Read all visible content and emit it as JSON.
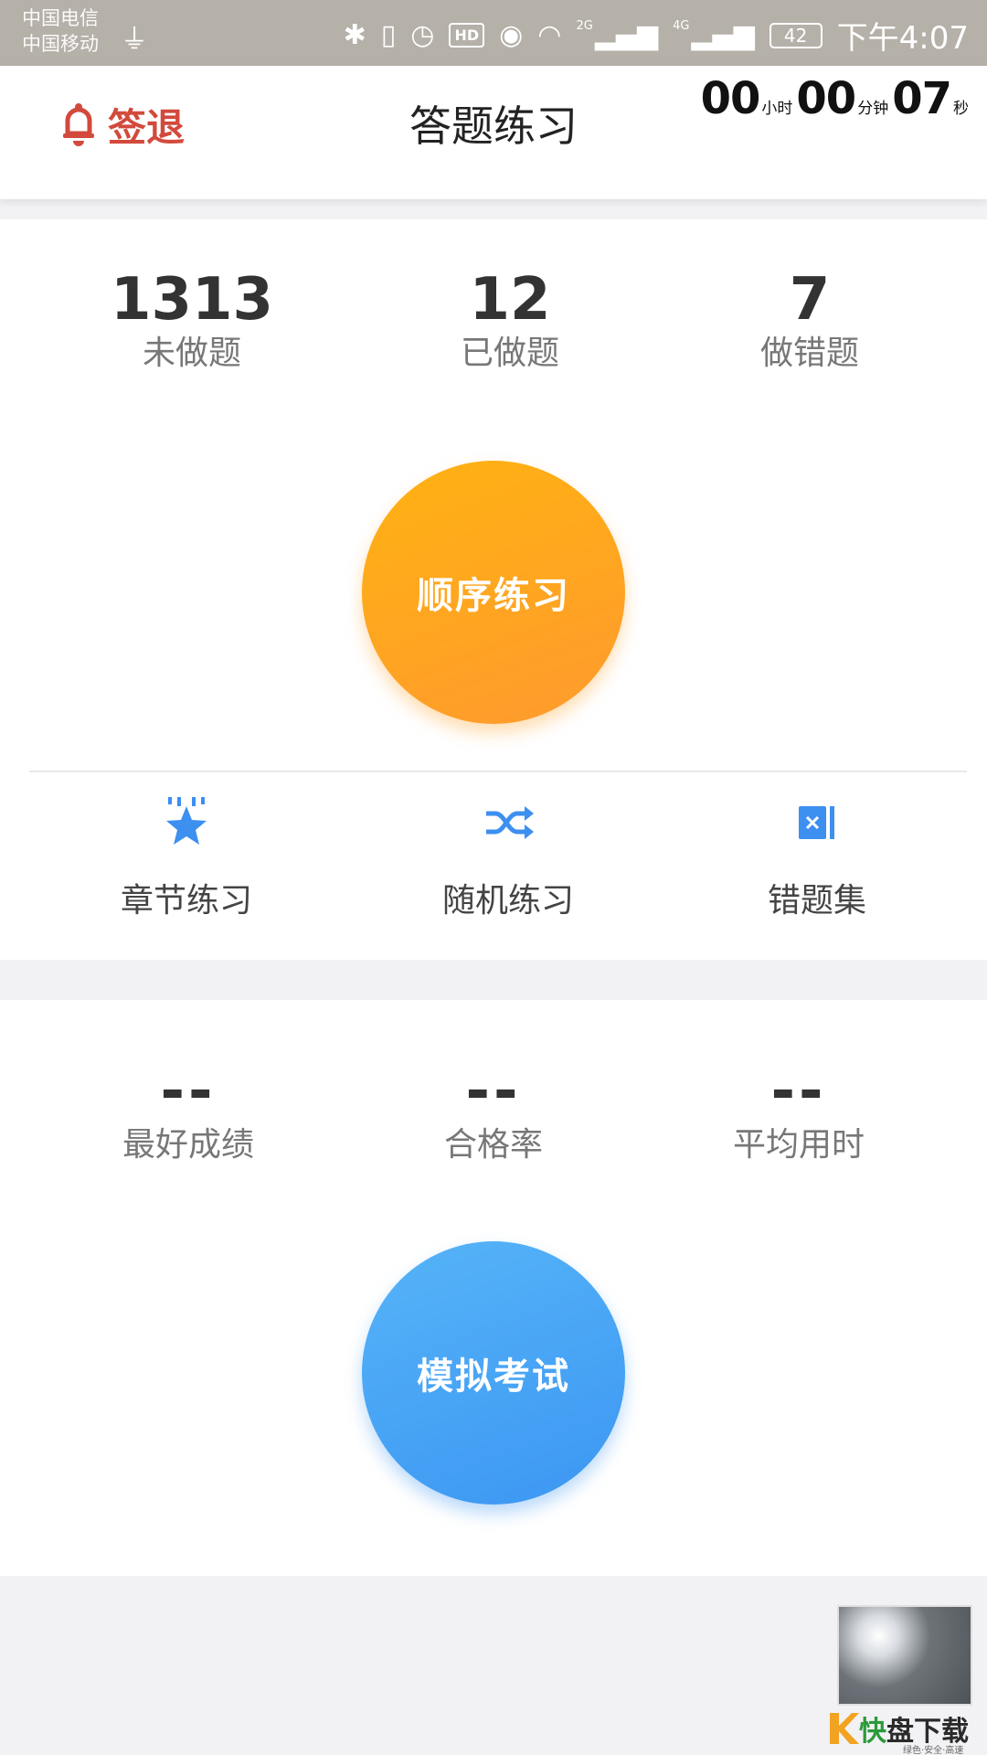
{
  "status_bar": {
    "carrier1": "中国电信",
    "carrier2": "中国移动",
    "network_2g": "2G",
    "network_4g": "4G",
    "hd": "HD",
    "battery": "42",
    "time": "下午4:07"
  },
  "header": {
    "signout_label": "签退",
    "title": "答题练习",
    "timer": {
      "hours": "00",
      "hours_unit": "小时",
      "minutes": "00",
      "minutes_unit": "分钟",
      "seconds": "07",
      "seconds_unit": "秒"
    }
  },
  "practice": {
    "stats": [
      {
        "value": "1313",
        "label": "未做题"
      },
      {
        "value": "12",
        "label": "已做题"
      },
      {
        "value": "7",
        "label": "做错题"
      }
    ],
    "main_button": "顺序练习",
    "modes": [
      {
        "label": "章节练习",
        "icon": "star-icon"
      },
      {
        "label": "随机练习",
        "icon": "shuffle-icon"
      },
      {
        "label": "错题集",
        "icon": "wrong-book-icon"
      }
    ]
  },
  "exam": {
    "stats": [
      {
        "value": "--",
        "label": "最好成绩"
      },
      {
        "value": "--",
        "label": "合格率"
      },
      {
        "value": "--",
        "label": "平均用时"
      }
    ],
    "main_button": "模拟考试"
  },
  "watermark": {
    "text_green": "快",
    "text_dark": "盘下载",
    "sub": "绿色·安全·高速"
  },
  "colors": {
    "accent_red": "#d24a3c",
    "orange": "#ffa51e",
    "blue": "#4aa6f6"
  }
}
